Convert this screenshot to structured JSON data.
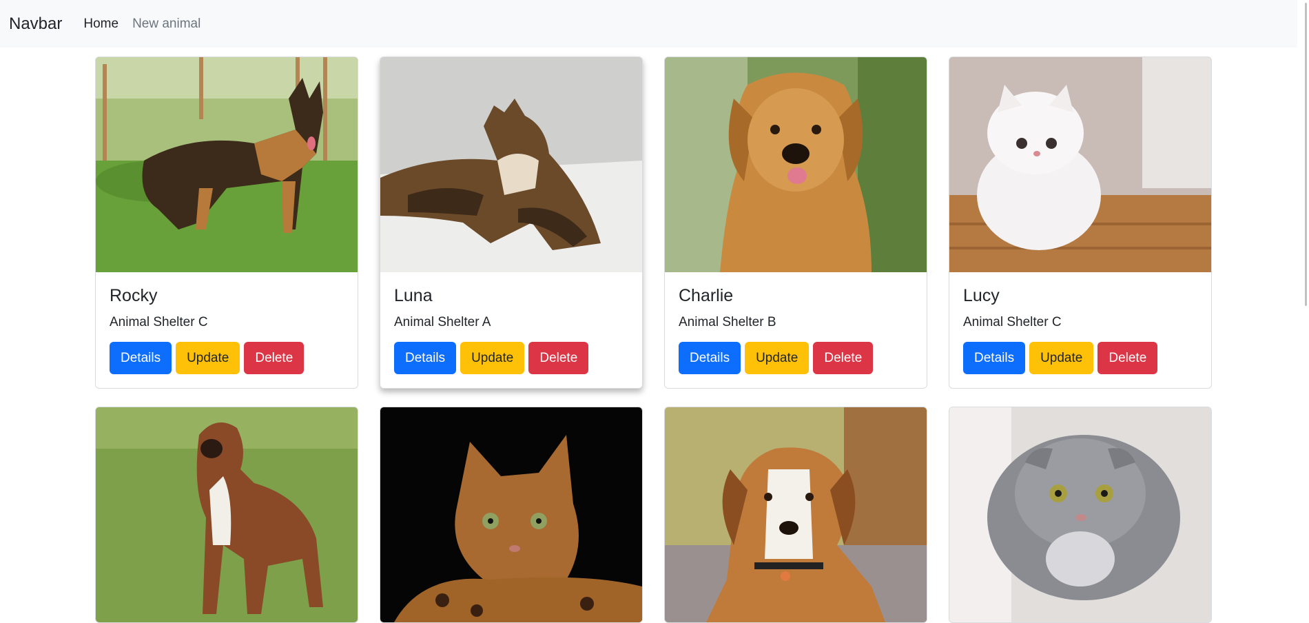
{
  "navbar": {
    "brand": "Navbar",
    "links": [
      {
        "label": "Home"
      },
      {
        "label": "New animal"
      }
    ]
  },
  "buttons": {
    "details": "Details",
    "update": "Update",
    "delete": "Delete"
  },
  "animals": [
    {
      "name": "Rocky",
      "shelter": "Animal Shelter C"
    },
    {
      "name": "Luna",
      "shelter": "Animal Shelter A"
    },
    {
      "name": "Charlie",
      "shelter": "Animal Shelter B"
    },
    {
      "name": "Lucy",
      "shelter": "Animal Shelter C"
    }
  ],
  "colors": {
    "navbar_bg": "#f8f9fa",
    "details": "#0d6efd",
    "update": "#ffc107",
    "delete": "#dc3545"
  }
}
